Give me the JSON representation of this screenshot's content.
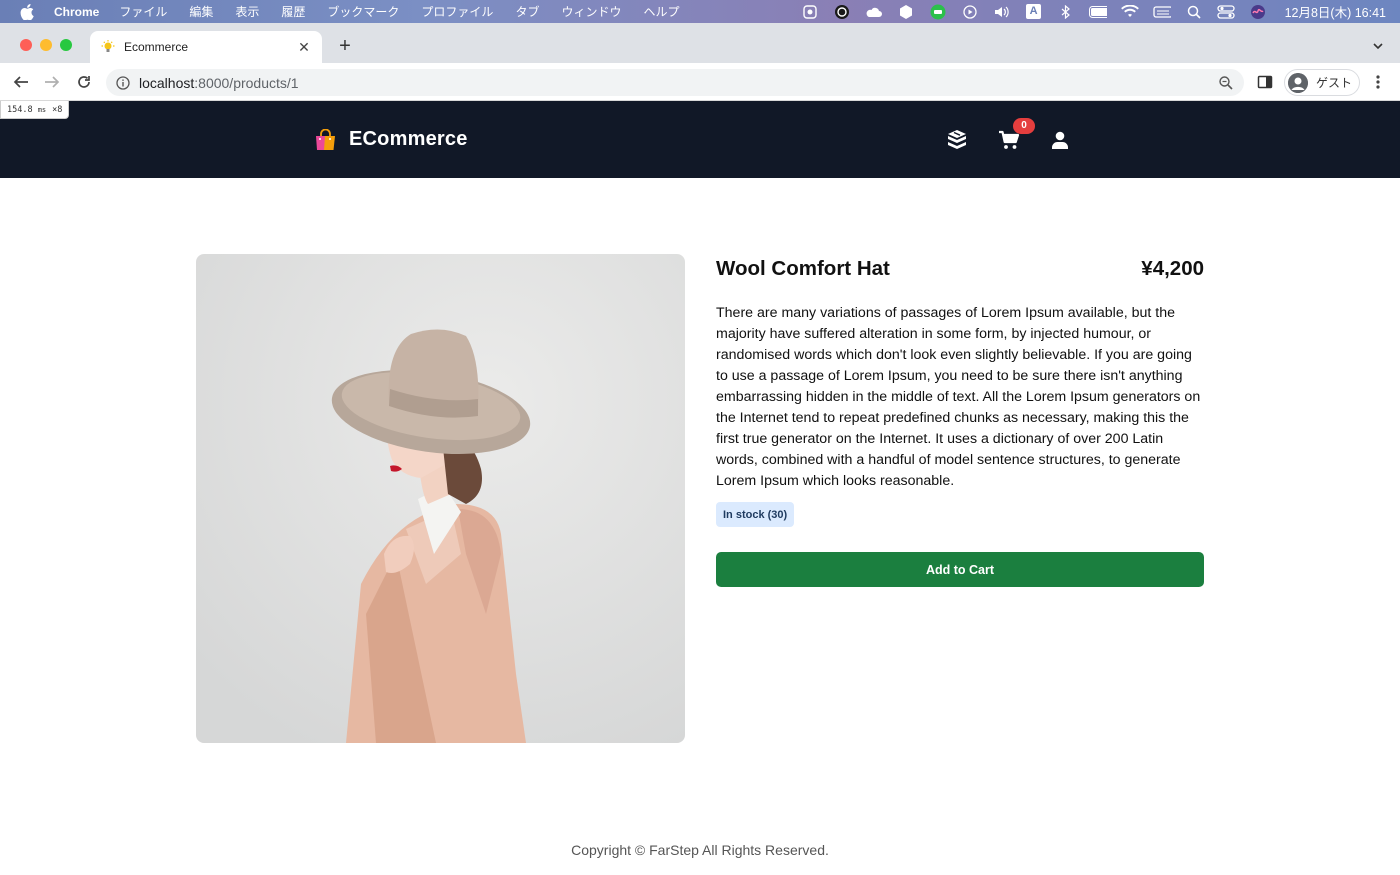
{
  "menubar": {
    "app_name": "Chrome",
    "items": [
      "ファイル",
      "編集",
      "表示",
      "履歴",
      "ブックマーク",
      "プロファイル",
      "タブ",
      "ウィンドウ",
      "ヘルプ"
    ],
    "clock": "12月8日(木) 16:41",
    "input_mode": "A"
  },
  "browser": {
    "tab_title": "Ecommerce",
    "url_host": "localhost",
    "url_path": ":8000/products/1",
    "profile_label": "ゲスト"
  },
  "timing": {
    "value": "154.8",
    "unit": "ms",
    "close": "×8"
  },
  "header": {
    "brand_name": "ECommerce",
    "cart_count": "0"
  },
  "product": {
    "name": "Wool Comfort Hat",
    "price": "¥4,200",
    "description": "There are many variations of passages of Lorem Ipsum available, but the majority have suffered alteration in some form, by injected humour, or randomised words which don't look even slightly believable. If you are going to use a passage of Lorem Ipsum, you need to be sure there isn't anything embarrassing hidden in the middle of text. All the Lorem Ipsum generators on the Internet tend to repeat predefined chunks as necessary, making this the first true generator on the Internet. It uses a dictionary of over 200 Latin words, combined with a handful of model sentence structures, to generate Lorem Ipsum which looks reasonable.",
    "stock_label": "In stock (30)",
    "add_to_cart_label": "Add to Cart"
  },
  "footer": {
    "copyright": "Copyright © FarStep All Rights Reserved."
  },
  "icons": {
    "brand": "shopping-bag-icon",
    "orders": "boxes-icon",
    "cart": "cart-icon",
    "user": "user-icon"
  },
  "colors": {
    "header_bg": "#111827",
    "add_to_cart": "#1b7f3f",
    "stock_badge_bg": "#dbeafe",
    "cart_badge": "#e53e3e"
  }
}
